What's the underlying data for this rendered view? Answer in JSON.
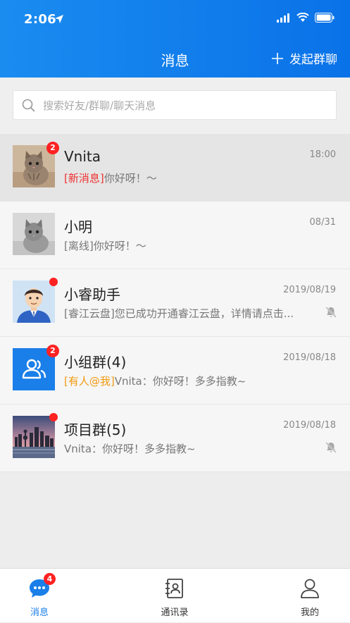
{
  "status_bar": {
    "time": "2:06"
  },
  "nav": {
    "title": "消息",
    "action_label": "发起群聊"
  },
  "search": {
    "placeholder": "搜索好友/群聊/聊天消息",
    "value": ""
  },
  "chats": [
    {
      "name": "Vnita",
      "time": "18:00",
      "tag": "[新消息]",
      "preview": "你好呀！～",
      "badge": "2",
      "avatar": "kitten-photo"
    },
    {
      "name": "小明",
      "time": "08/31",
      "tag": "",
      "preview": "[离线]你好呀！～",
      "badge": "",
      "avatar": "kitten-gray-photo"
    },
    {
      "name": "小睿助手",
      "time": "2019/08/19",
      "tag": "",
      "preview": "[睿江云盘]您已成功开通睿江云盘，详情请点击...",
      "badge": "dot",
      "avatar": "assistant-avatar",
      "muted": true
    },
    {
      "name": "小组群(4)",
      "time": "2019/08/18",
      "tag": "[有人@我]",
      "preview": "Vnita：你好呀！多多指教~",
      "badge": "2",
      "avatar": "group-icon"
    },
    {
      "name": "项目群(5)",
      "time": "2019/08/18",
      "tag": "",
      "preview": "Vnita：你好呀！多多指教~",
      "badge": "dot",
      "avatar": "city-photo",
      "muted": true
    }
  ],
  "tabs": [
    {
      "label": "消息",
      "icon": "chat-icon",
      "badge": "4",
      "active": true
    },
    {
      "label": "通讯录",
      "icon": "contacts-icon"
    },
    {
      "label": "我的",
      "icon": "person-icon"
    }
  ],
  "colors": {
    "primary": "#1a7fe8",
    "badge": "#f22222",
    "new_tag": "#f03030",
    "mention_tag": "#f29a10"
  }
}
